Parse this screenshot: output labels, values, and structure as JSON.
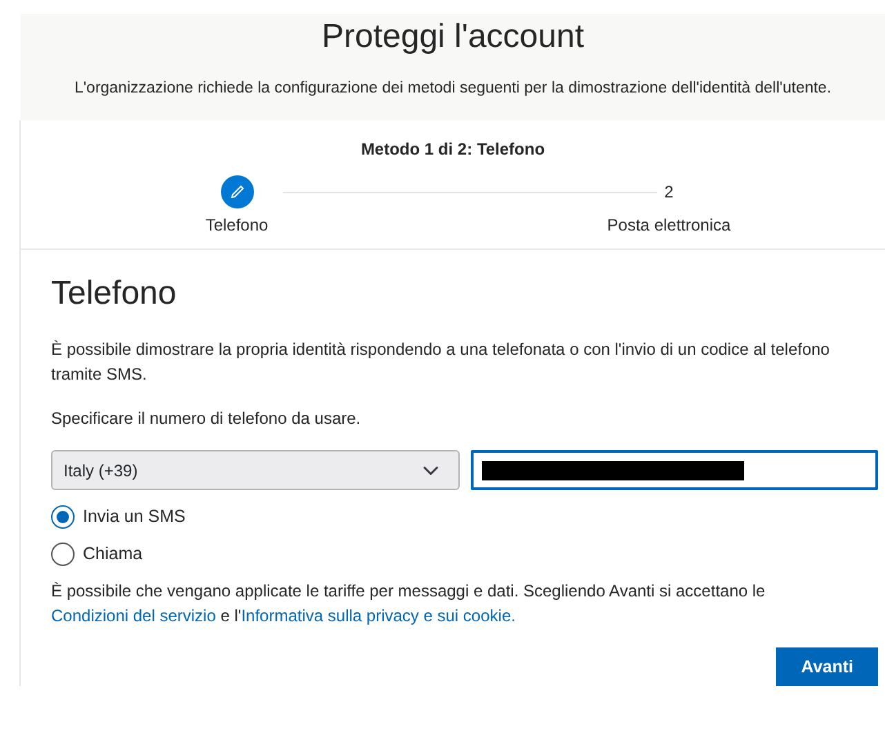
{
  "header": {
    "title": "Proteggi l'account",
    "subtitle": "L'organizzazione richiede la configurazione dei metodi seguenti per la dimostrazione dell'identità dell'utente."
  },
  "progress": {
    "caption": "Metodo 1 di 2: Telefono",
    "steps": [
      {
        "label": "Telefono",
        "selected": true
      },
      {
        "number": "2",
        "label": "Posta elettronica",
        "selected": false
      }
    ]
  },
  "section": {
    "title": "Telefono",
    "description": "È possibile dimostrare la propria identità rispondendo a una telefonata o con l'invio di un codice al telefono tramite SMS.",
    "prompt": "Specificare il numero di telefono da usare."
  },
  "country_select": {
    "value": "Italy (+39)"
  },
  "phone_field": {
    "redacted": true,
    "focused": true
  },
  "options": [
    {
      "label": "Invia un SMS",
      "selected": true
    },
    {
      "label": "Chiama",
      "selected": false
    }
  ],
  "note": [
    {
      "kind": "text",
      "text": "È possibile che vengano applicate le tariffe per messaggi e dati. Scegliendo Avanti si accettano le "
    },
    {
      "kind": "link",
      "text": "Condizioni del servizio"
    },
    {
      "kind": "text",
      "text": " e l'"
    },
    {
      "kind": "link",
      "text": "Informativa sulla privacy e sui cookie."
    }
  ],
  "buttons": [
    {
      "label": "Avanti"
    }
  ]
}
